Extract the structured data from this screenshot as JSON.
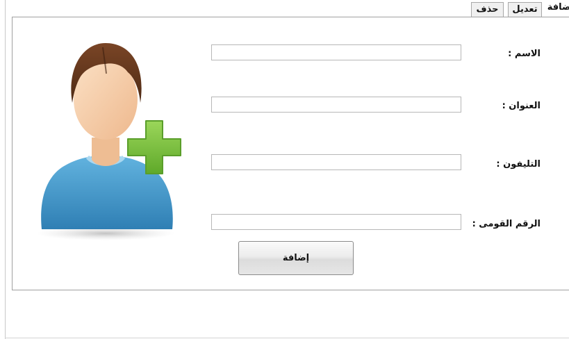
{
  "tabs": {
    "add_label": "إضافة",
    "edit_label": "تعديل",
    "delete_label": "حذف"
  },
  "form": {
    "name_label": "الاسم :",
    "name_value": "",
    "address_label": "العنوان :",
    "address_value": "",
    "phone_label": "التليفون :",
    "phone_value": "",
    "national_id_label": "الرقم القومى :",
    "national_id_value": "",
    "add_button_label": "إضافة"
  },
  "icons": {
    "avatar": "add-user-icon"
  },
  "colors": {
    "shirt": "#3f95c8",
    "hair": "#6b3a1e",
    "skin": "#f3c9a0",
    "plus": "#7cc43a"
  }
}
